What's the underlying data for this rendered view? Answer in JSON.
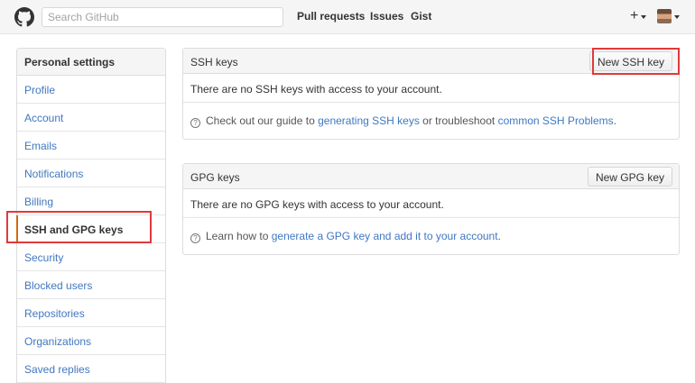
{
  "header": {
    "search_placeholder": "Search GitHub",
    "nav": [
      "Pull requests",
      "Issues",
      "Gist"
    ],
    "plus_label": "+",
    "icons": {
      "logo": "github-octocat-icon",
      "plus": "plus-icon",
      "avatar": "user-avatar"
    }
  },
  "sidebar": {
    "heading": "Personal settings",
    "items": [
      "Profile",
      "Account",
      "Emails",
      "Notifications",
      "Billing",
      "SSH and GPG keys",
      "Security",
      "Blocked users",
      "Repositories",
      "Organizations",
      "Saved replies"
    ],
    "selected": "SSH and GPG keys"
  },
  "ssh": {
    "title": "SSH keys",
    "button": "New SSH key",
    "empty": "There are no SSH keys with access to your account.",
    "help_pre": "Check out our guide to",
    "help_link1": "generating SSH keys",
    "help_mid": "or troubleshoot",
    "help_link2": "common SSH Problems",
    "help_end": "."
  },
  "gpg": {
    "title": "GPG keys",
    "button": "New GPG key",
    "empty": "There are no GPG keys with access to your account.",
    "help_pre": "Learn how to",
    "help_link": "generate a GPG key and add it to your account",
    "help_end": "."
  },
  "colors": {
    "link": "#4078c0",
    "selected_accent": "#d26911",
    "highlight": "#e03a3a"
  }
}
